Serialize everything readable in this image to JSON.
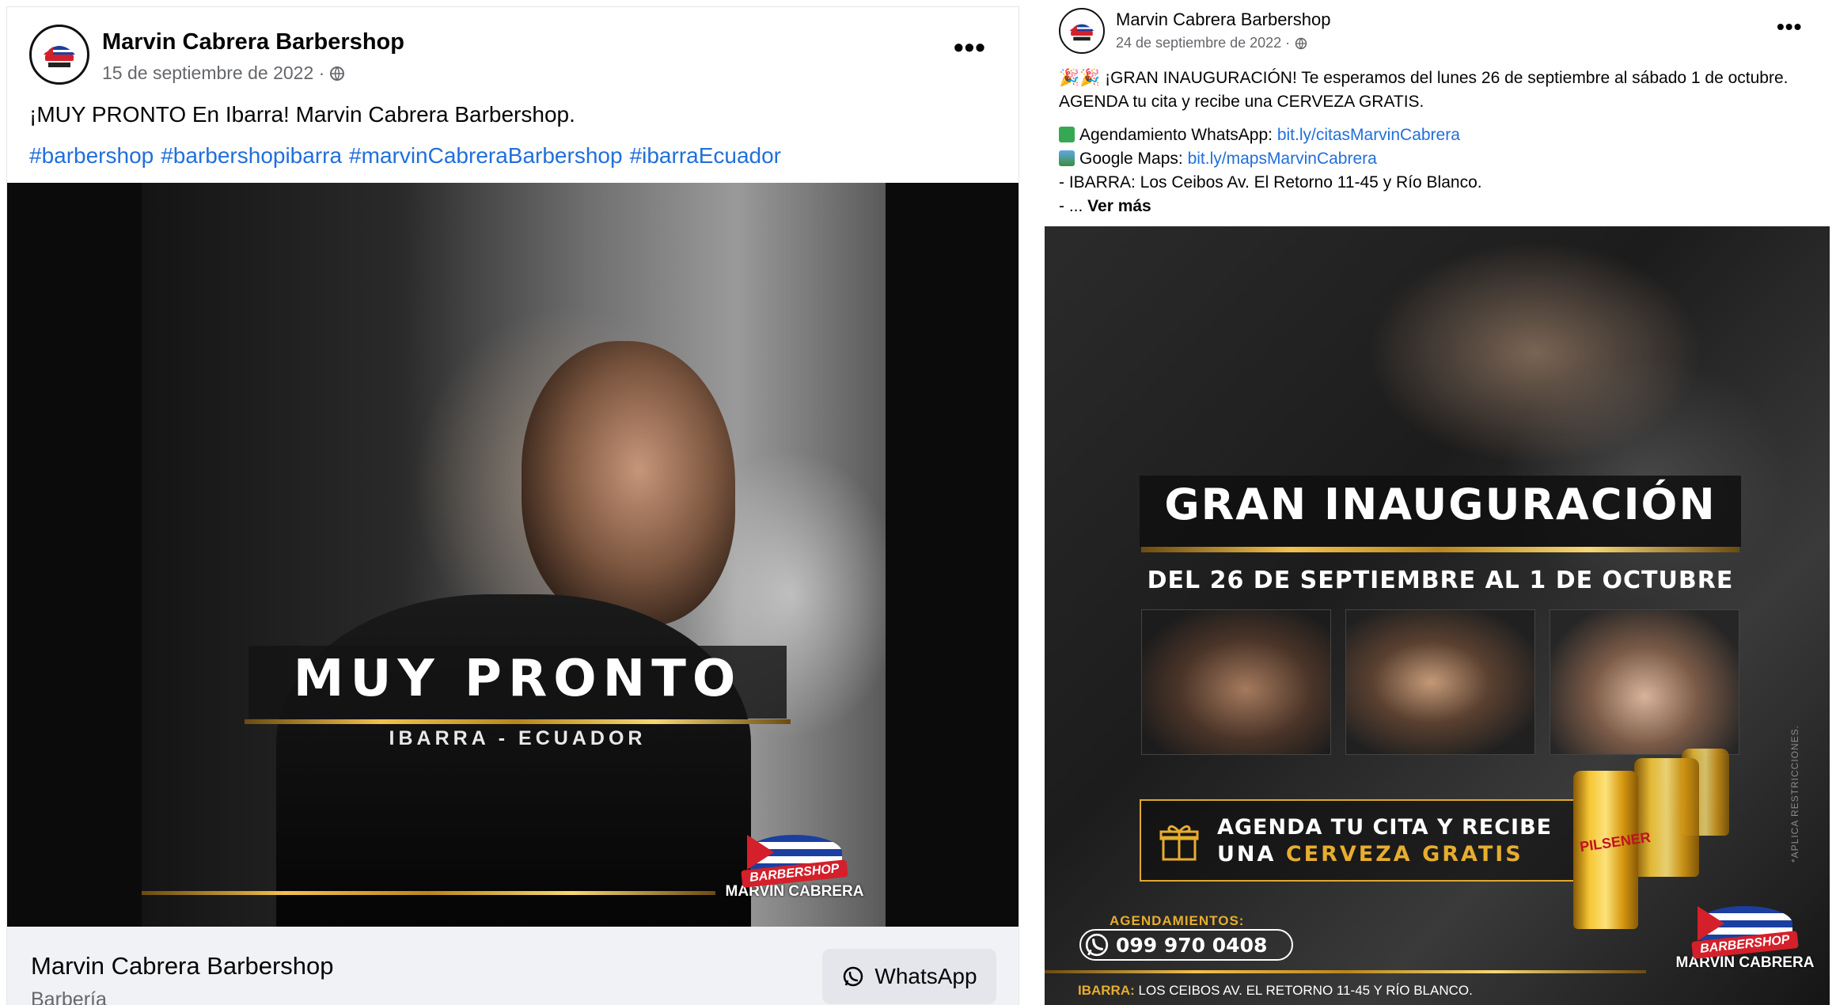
{
  "left_post": {
    "page_name": "Marvin Cabrera Barbershop",
    "date": "15 de septiembre de 2022 ·",
    "text": "¡MUY PRONTO En Ibarra! Marvin Cabrera Barbershop.",
    "hashtags": [
      "#barbershop",
      "#barbershopibarra",
      "#marvinCabreraBarbershop",
      "#ibarraEcuador"
    ],
    "image": {
      "headline": "MUY PRONTO",
      "subheadline": "IBARRA - ECUADOR",
      "logo": {
        "banner": "BARBERSHOP",
        "name": "MARVIN CABRERA"
      }
    },
    "footer": {
      "page_name": "Marvin Cabrera Barbershop",
      "category": "Barbería",
      "button_label": "WhatsApp"
    }
  },
  "right_post": {
    "page_name": "Marvin Cabrera Barbershop",
    "date": "24 de septiembre de 2022 ·",
    "body": {
      "line1": "🎉🎉 ¡GRAN INAUGURACIÓN! Te esperamos del lunes 26 de septiembre al sábado 1 de octubre.",
      "line2": "AGENDA tu cita y recibe una CERVEZA GRATIS.",
      "whatsapp_prefix": "Agendamiento WhatsApp: ",
      "whatsapp_link": "bit.ly/citasMarvinCabrera",
      "maps_prefix": "Google Maps: ",
      "maps_link": "bit.ly/mapsMarvinCabrera",
      "address_line": "- IBARRA: Los Ceibos Av. El Retorno 11-45 y Río Blanco.",
      "ellipsis": "- ... ",
      "see_more": "Ver más"
    },
    "image": {
      "title": "GRAN INAUGURACIÓN",
      "subtitle": "DEL 26 DE SEPTIEMBRE AL 1 DE OCTUBRE",
      "cta_line1": "AGENDA TU CITA Y RECIBE",
      "cta_line2_prefix": "UNA ",
      "cta_line2_highlight": "CERVEZA GRATIS",
      "can_label": "PILSENER",
      "restrictions": "*APLICA RESTRICCIONES.",
      "schedule_label": "AGENDAMIENTOS:",
      "phone": "099 970 0408",
      "address_city": "IBARRA:",
      "address": "LOS CEIBOS AV. EL RETORNO 11-45 Y RÍO BLANCO.",
      "logo": {
        "banner": "BARBERSHOP",
        "name": "MARVIN CABRERA"
      }
    }
  },
  "colors": {
    "link": "#216fdb",
    "gold": "#e6ad2f",
    "secondary_text": "#65676b",
    "footer_bg": "#f0f2f5",
    "logo_red": "#d4202a",
    "logo_blue": "#1b3fa0"
  },
  "icons": {
    "privacy": "globe-icon",
    "more": "more-options-icon",
    "whatsapp": "whatsapp-icon",
    "check": "check-mark-icon",
    "map": "map-icon",
    "gift": "gift-icon",
    "phone": "whatsapp-phone-icon"
  }
}
